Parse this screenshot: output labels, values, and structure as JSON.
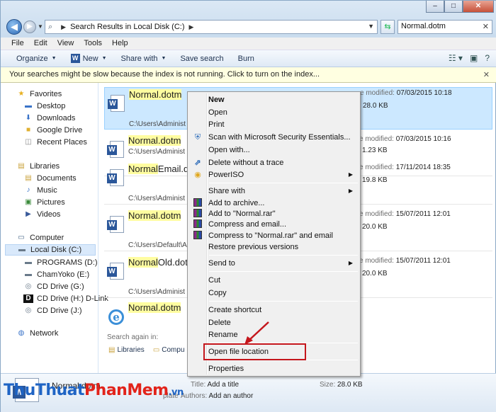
{
  "window": {
    "minimize_label": "–",
    "maximize_label": "□",
    "close_label": "✕"
  },
  "address": {
    "path": "Search Results in Local Disk (C:)",
    "search_value": "Normal.dotm"
  },
  "menubar": [
    "File",
    "Edit",
    "View",
    "Tools",
    "Help"
  ],
  "toolbar": {
    "organize": "Organize",
    "new": "New",
    "share_with": "Share with",
    "save_search": "Save search",
    "burn": "Burn"
  },
  "infobar": {
    "text": "Your searches might be slow because the index is not running.  Click to turn on the index..."
  },
  "sidebar": {
    "favorites": "Favorites",
    "desktop": "Desktop",
    "downloads": "Downloads",
    "google_drive": "Google Drive",
    "recent_places": "Recent Places",
    "libraries": "Libraries",
    "documents": "Documents",
    "music": "Music",
    "pictures": "Pictures",
    "videos": "Videos",
    "computer": "Computer",
    "local_disk": "Local Disk (C:)",
    "programs": "PROGRAMS (D:)",
    "chamyoko": "ChamYoko (E:)",
    "cd_g": "CD Drive (G:)",
    "cd_h": "CD Drive (H:) D-Link",
    "cd_j": "CD Drive (J:)",
    "network": "Network"
  },
  "files": [
    {
      "hl": "Normal.dotm",
      "rest": "",
      "path": "C:\\Users\\Administ",
      "modified_label": "e modified:",
      "modified": "07/03/2015 10:18",
      "size": "28.0 KB"
    },
    {
      "hl": "Normal.dotm",
      "rest": "",
      "path": "C:\\Users\\Administ",
      "modified_label": "e modified:",
      "modified": "07/03/2015 10:16",
      "size": "1.23 KB"
    },
    {
      "hl": "Normal",
      "rest": "Email.do",
      "path": "C:\\Users\\Administ",
      "modified_label": "e modified:",
      "modified": "17/11/2014 18:35",
      "size": "19.8 KB"
    },
    {
      "hl": "Normal.dotm",
      "rest": "",
      "path": "C:\\Users\\Default\\Ap",
      "modified_label": "e modified:",
      "modified": "15/07/2011 12:01",
      "size": "20.0 KB"
    },
    {
      "hl": "Normal",
      "rest": "Old.dotm",
      "path": "C:\\Users\\Administ",
      "modified_label": "e modified:",
      "modified": "15/07/2011 12:01",
      "size": "20.0 KB"
    },
    {
      "hl": "Normal.dotm",
      "rest": "",
      "path": "",
      "modified_label": "",
      "modified": "",
      "size": ""
    }
  ],
  "search_again": {
    "label": "Search again in:",
    "libraries": "Libraries",
    "computer": "Compu"
  },
  "context_menu": {
    "new": "New",
    "open": "Open",
    "print": "Print",
    "scan": "Scan with Microsoft Security Essentials...",
    "open_with": "Open with...",
    "delete_trace": "Delete without a trace",
    "poweriso": "PowerISO",
    "share_with": "Share with",
    "add_archive": "Add to archive...",
    "add_rar": "Add to \"Normal.rar\"",
    "compress_email": "Compress and email...",
    "compress_rar_email": "Compress to \"Normal.rar\" and email",
    "restore": "Restore previous versions",
    "send_to": "Send to",
    "cut": "Cut",
    "copy": "Copy",
    "create_shortcut": "Create shortcut",
    "delete": "Delete",
    "rename": "Rename",
    "open_location": "Open file location",
    "properties": "Properties"
  },
  "details": {
    "name": "Normal.dotm",
    "type_suffix": "plate",
    "title_label": "Title:",
    "title_value": "Add a title",
    "authors_label": "Authors:",
    "authors_value": "Add an author",
    "size_label": "Size:",
    "size_value": "28.0 KB"
  },
  "watermark": {
    "part1": "ThuThuat",
    "part2": "PhanMem",
    "part3": ".vn"
  },
  "colors": {
    "selection": "#cce8ff",
    "highlight": "#fffda0",
    "annotation": "#c4161c"
  }
}
